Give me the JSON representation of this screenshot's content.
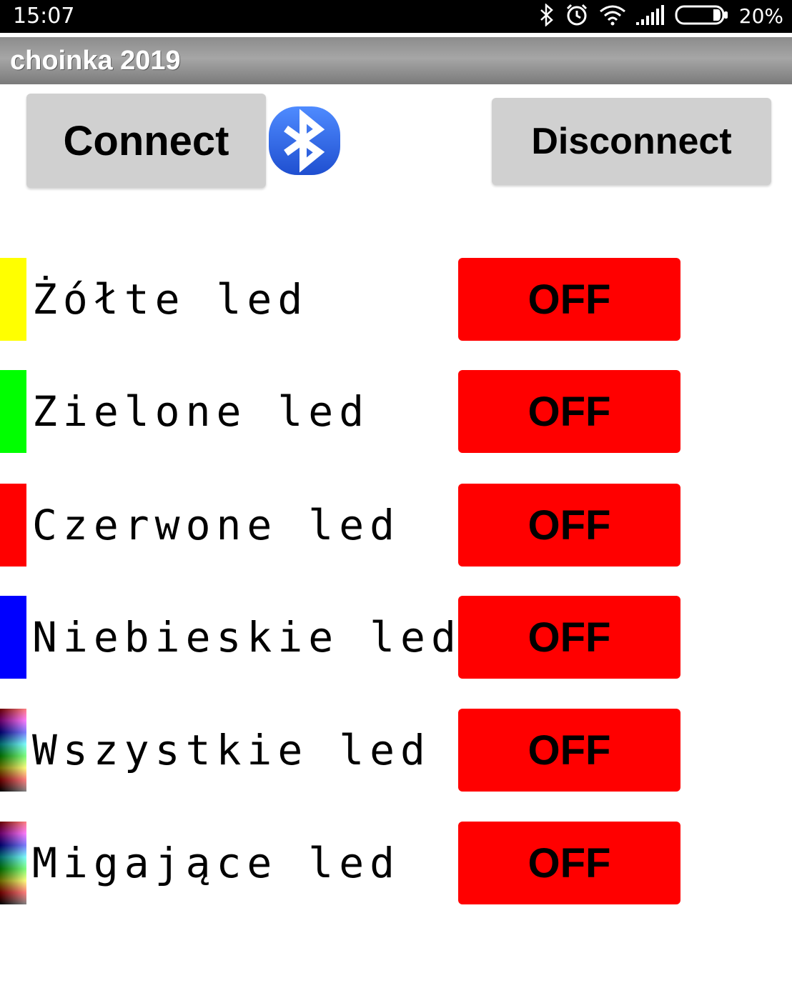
{
  "status_bar": {
    "time": "15:07",
    "battery_percent": "20%",
    "icons": [
      "bluetooth-icon",
      "alarm-icon",
      "wifi-icon",
      "signal-icon",
      "battery-icon"
    ],
    "battery_level": 0.2
  },
  "app": {
    "title": "choinka 2019"
  },
  "toolbar": {
    "connect_label": "Connect",
    "disconnect_label": "Disconnect",
    "bluetooth_icon": "bluetooth-icon",
    "bluetooth_color": "#2f6fe6"
  },
  "leds": [
    {
      "label": "Żółte led",
      "state": "OFF",
      "color": "#ffff00"
    },
    {
      "label": "Zielone led",
      "state": "OFF",
      "color": "#00ff00"
    },
    {
      "label": "Czerwone led",
      "state": "OFF",
      "color": "#ff0000"
    },
    {
      "label": "Niebieskie led",
      "state": "OFF",
      "color": "#0000ff"
    },
    {
      "label": "Wszystkie led",
      "state": "OFF",
      "color": "multicolor"
    },
    {
      "label": "Migające led",
      "state": "OFF",
      "color": "multicolor"
    }
  ],
  "colors": {
    "off_button": "#ff0000",
    "grey_button": "#d0d0d0",
    "title_bar": "#999999"
  }
}
